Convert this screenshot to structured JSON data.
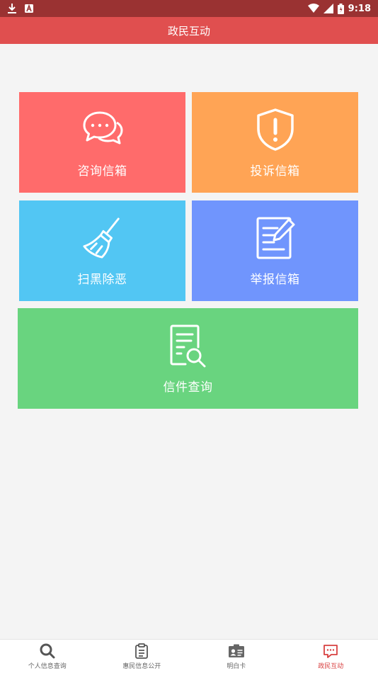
{
  "status_bar": {
    "time": "9:18",
    "icons": [
      "download-icon",
      "notification-a-icon",
      "wifi-icon",
      "signal-icon",
      "battery-icon"
    ]
  },
  "app_bar": {
    "title": "政民互动"
  },
  "tiles": [
    {
      "label": "咨询信箱",
      "icon": "chat-bubbles-icon",
      "color": "#ff6b6b"
    },
    {
      "label": "投诉信箱",
      "icon": "shield-alert-icon",
      "color": "#ffa455"
    },
    {
      "label": "扫黑除恶",
      "icon": "broom-icon",
      "color": "#52c6f3"
    },
    {
      "label": "举报信箱",
      "icon": "edit-document-icon",
      "color": "#7095fd"
    },
    {
      "label": "信件查询",
      "icon": "document-search-icon",
      "color": "#69d47f"
    }
  ],
  "bottom_nav": {
    "active_index": 3,
    "active_color": "#d84040",
    "items": [
      {
        "label": "个人信息查询",
        "icon": "search-icon"
      },
      {
        "label": "惠民信息公开",
        "icon": "clipboard-icon"
      },
      {
        "label": "明白卡",
        "icon": "id-card-icon"
      },
      {
        "label": "政民互动",
        "icon": "chat-icon"
      }
    ]
  }
}
